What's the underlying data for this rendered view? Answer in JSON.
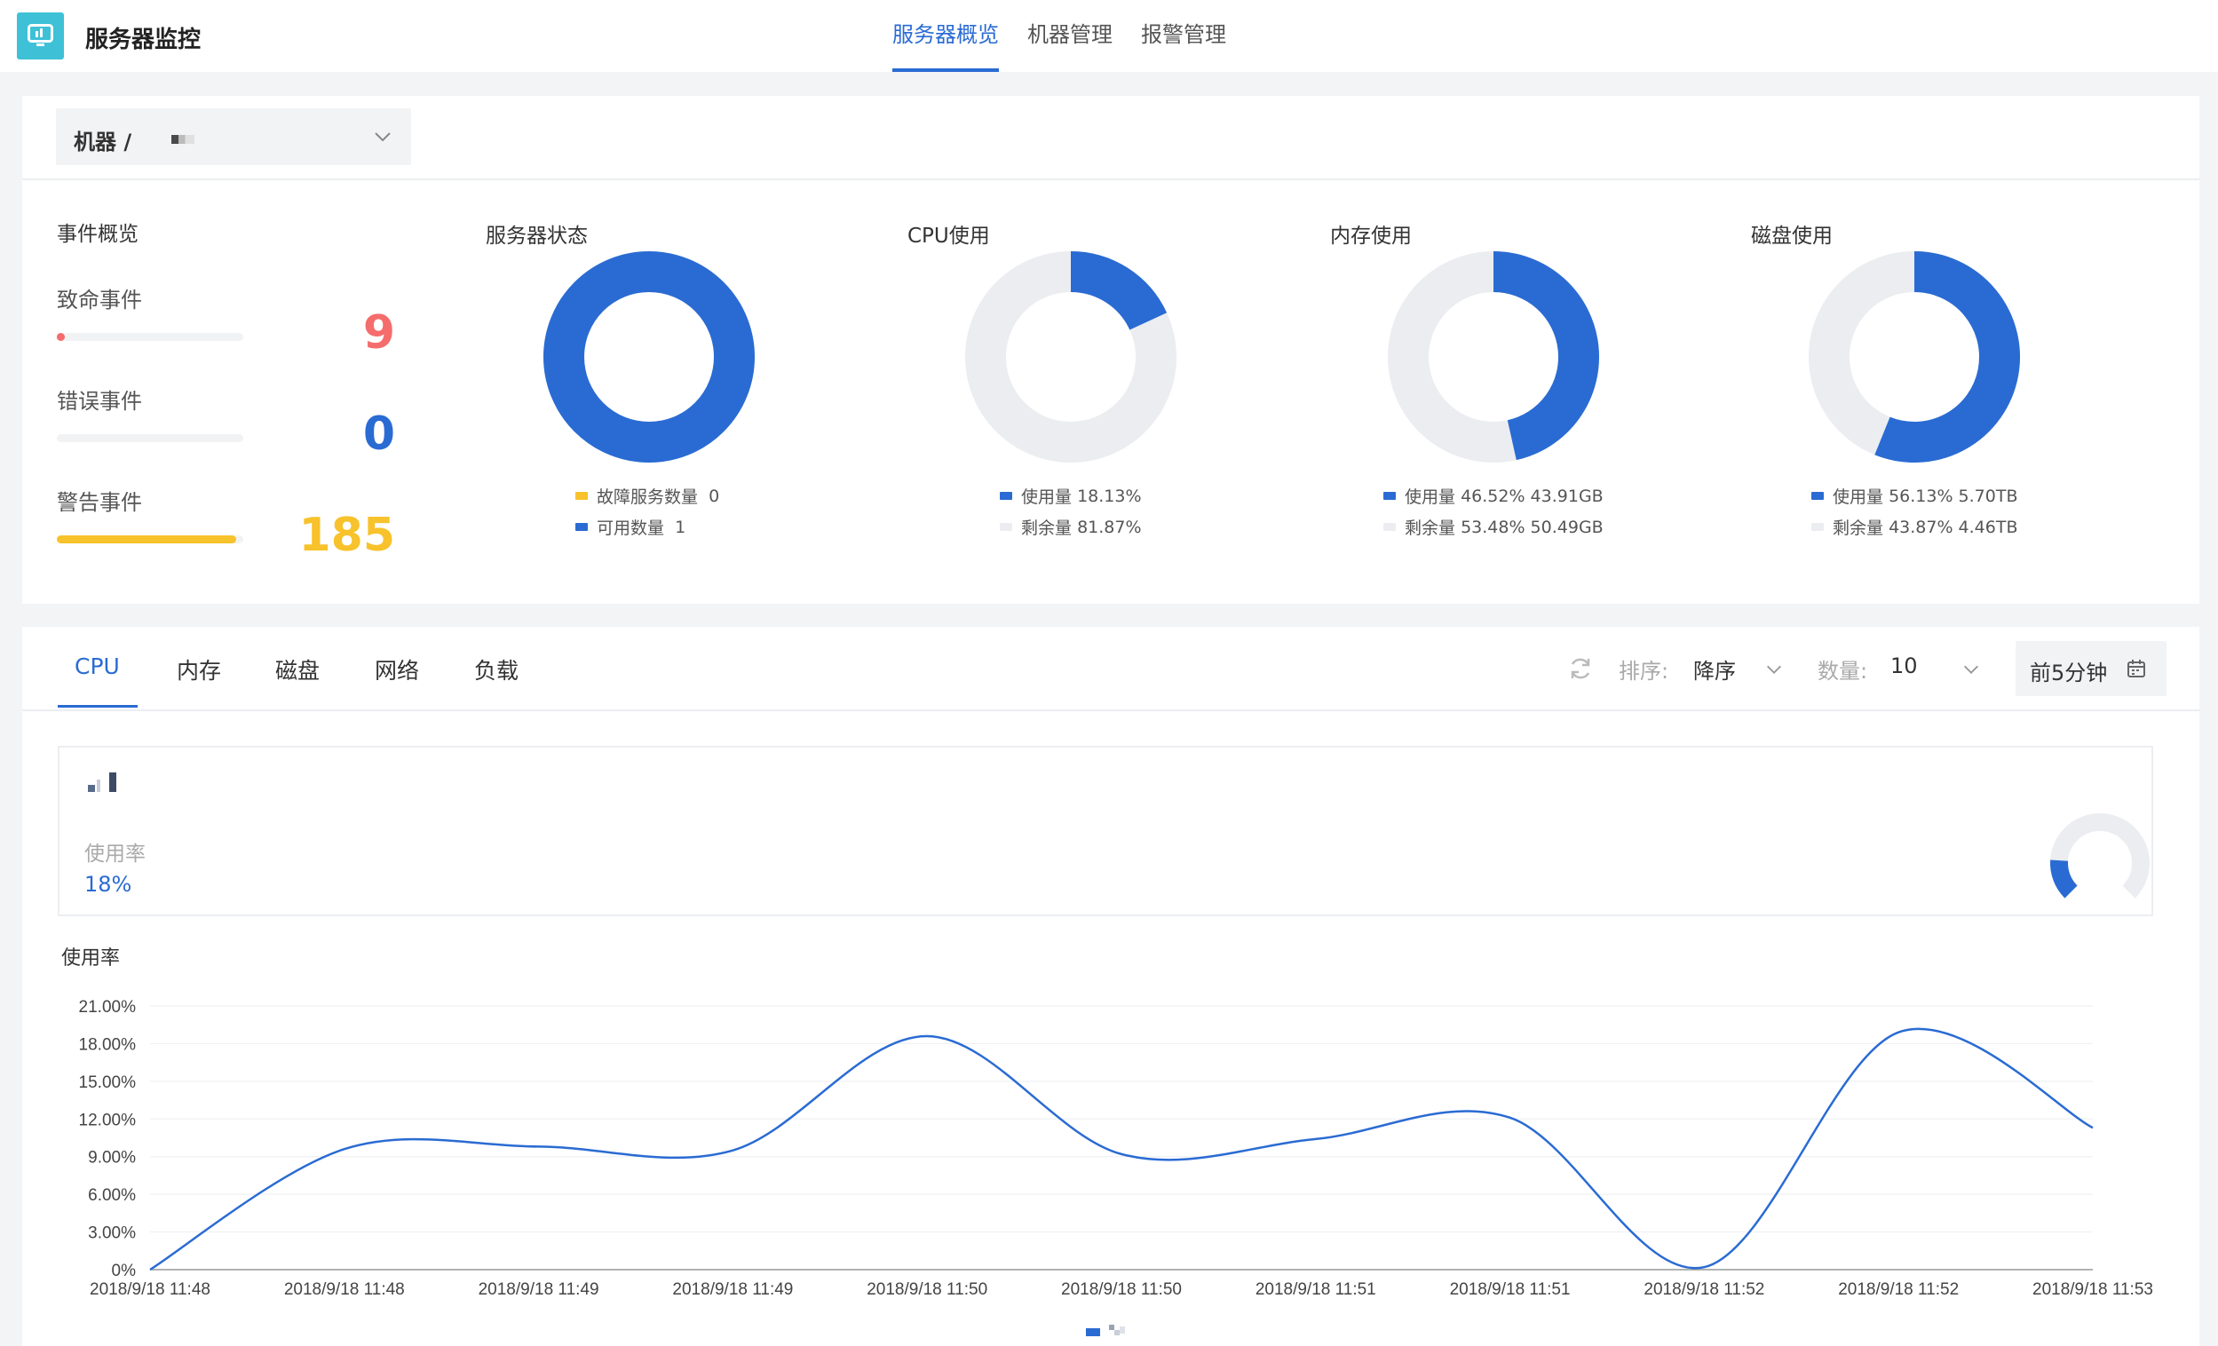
{
  "header": {
    "app_title": "服务器监控",
    "nav": [
      {
        "label": "服务器概览",
        "active": true
      },
      {
        "label": "机器管理",
        "active": false
      },
      {
        "label": "报警管理",
        "active": false
      }
    ]
  },
  "machine_select": {
    "label": "机器 /"
  },
  "events": {
    "title": "事件概览",
    "items": [
      {
        "label": "致命事件",
        "value": "9",
        "color": "#f56c6c",
        "fill": 0.02
      },
      {
        "label": "错误事件",
        "value": "0",
        "color": "#2a6bd3",
        "fill": 0
      },
      {
        "label": "警告事件",
        "value": "185",
        "color": "#f7c22b",
        "fill": 0.96
      }
    ]
  },
  "overview_charts": [
    {
      "title": "服务器状态",
      "used_fraction": 1.0,
      "legend": [
        {
          "label": "故障服务数量",
          "value": "0",
          "color": "#f7c22b"
        },
        {
          "label": "可用数量",
          "value": "1",
          "color": "#2a6bd3"
        }
      ]
    },
    {
      "title": "CPU使用",
      "used_fraction": 0.1813,
      "legend": [
        {
          "label": "使用量",
          "value": "18.13%",
          "color": "#2a6bd3"
        },
        {
          "label": "剩余量",
          "value": "81.87%",
          "color": "#ebedf0"
        }
      ]
    },
    {
      "title": "内存使用",
      "used_fraction": 0.4652,
      "legend": [
        {
          "label": "使用量",
          "value": "46.52% 43.91GB",
          "color": "#2a6bd3"
        },
        {
          "label": "剩余量",
          "value": "53.48% 50.49GB",
          "color": "#ebedf0"
        }
      ]
    },
    {
      "title": "磁盘使用",
      "used_fraction": 0.5613,
      "legend": [
        {
          "label": "使用量",
          "value": "56.13% 5.70TB",
          "color": "#2a6bd3"
        },
        {
          "label": "剩余量",
          "value": "43.87% 4.46TB",
          "color": "#ebedf0"
        }
      ]
    }
  ],
  "tabs": [
    {
      "label": "CPU",
      "active": true
    },
    {
      "label": "内存",
      "active": false
    },
    {
      "label": "磁盘",
      "active": false
    },
    {
      "label": "网络",
      "active": false
    },
    {
      "label": "负载",
      "active": false
    }
  ],
  "toolbar": {
    "refresh_icon": "refresh-icon",
    "sort_label": "排序:",
    "sort_value": "降序",
    "count_label": "数量:",
    "count_value": "10",
    "date_button": "前5分钟",
    "calendar_icon": "calendar-icon"
  },
  "summary": {
    "metric_label": "使用率",
    "metric_value": "18%",
    "used_fraction": 0.18
  },
  "colors": {
    "accent": "#2a6bd3",
    "track": "#ebedf0"
  },
  "chart_data": {
    "type": "line",
    "title": "",
    "ylabel": "使用率",
    "xlabel": "",
    "ylim": [
      0,
      21
    ],
    "yticks": [
      "0%",
      "3.00%",
      "6.00%",
      "9.00%",
      "12.00%",
      "15.00%",
      "18.00%",
      "21.00%"
    ],
    "grid": true,
    "legend": "bottom",
    "x": [
      "2018/9/18 11:48",
      "2018/9/18 11:48",
      "2018/9/18 11:49",
      "2018/9/18 11:49",
      "2018/9/18 11:50",
      "2018/9/18 11:50",
      "2018/9/18 11:51",
      "2018/9/18 11:51",
      "2018/9/18 11:52",
      "2018/9/18 11:52",
      "2018/9/18 11:53"
    ],
    "series": [
      {
        "values": [
          0.0,
          9.6,
          9.8,
          9.5,
          18.6,
          9.2,
          10.4,
          12.1,
          0.2,
          18.9,
          11.3
        ],
        "color": "#2a6bd3"
      }
    ]
  }
}
